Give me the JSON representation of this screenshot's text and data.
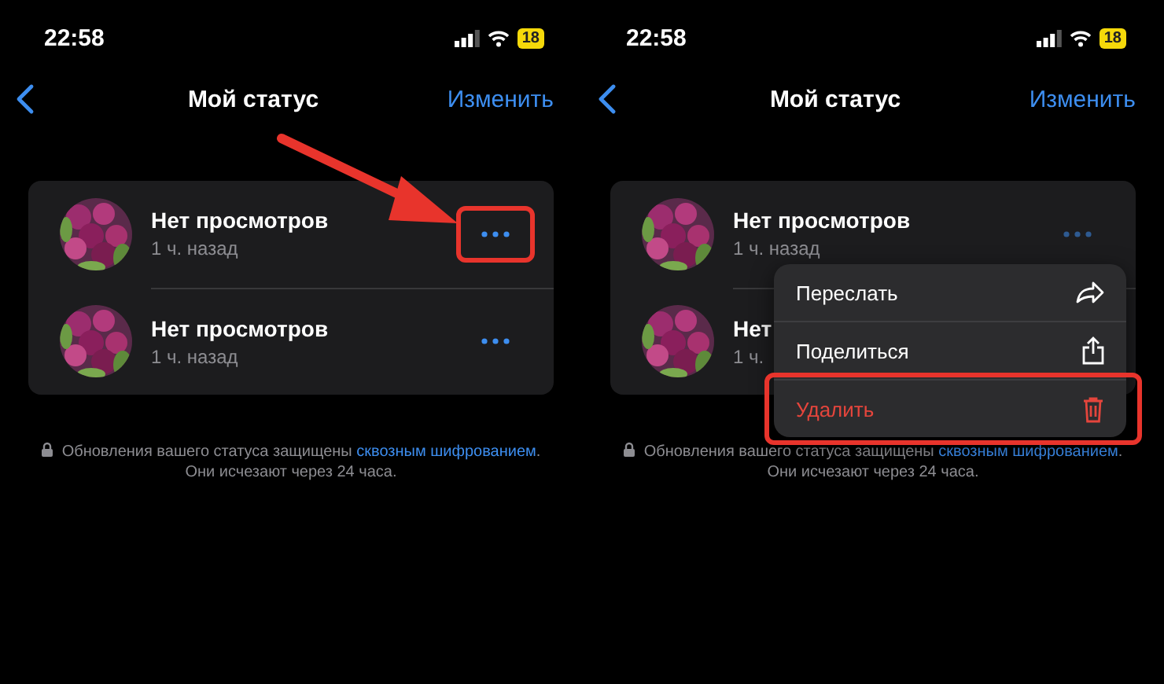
{
  "screens": [
    {
      "status_bar": {
        "time": "22:58",
        "battery": "18"
      },
      "title": "Мой статус",
      "action": "Изменить",
      "arrow": true,
      "statuses": [
        {
          "title": "Нет просмотров",
          "time": "1 ч. назад",
          "more_shown": true,
          "dimmed": false,
          "highlighted": true
        },
        {
          "title": "Нет просмотров",
          "time": "1 ч. назад",
          "more_shown": true,
          "dimmed": false,
          "highlighted": false
        }
      ],
      "note": {
        "text": "Обновления вашего статуса защищены ",
        "link": "сквозным шифрованием",
        "after": ". Они исчезают через 24 часа."
      }
    },
    {
      "status_bar": {
        "time": "22:58",
        "battery": "18"
      },
      "title": "Мой статус",
      "action": "Изменить",
      "statuses": [
        {
          "title": "Нет просмотров",
          "time": "1 ч. назад",
          "more_shown": true,
          "dimmed": true,
          "highlighted": false
        },
        {
          "title": "Нет",
          "time": "1 ч."
        }
      ],
      "menu": [
        {
          "label": "Переслать",
          "kind": "forward",
          "destructive": false,
          "highlighted": false
        },
        {
          "label": "Поделиться",
          "kind": "share",
          "destructive": false,
          "highlighted": false
        },
        {
          "label": "Удалить",
          "kind": "delete",
          "destructive": true,
          "highlighted": true
        }
      ],
      "note": {
        "text": "Обновления вашего статуса защищены ",
        "link": "сквозным шифрованием",
        "after": ". Они исчезают через 24 часа."
      }
    }
  ]
}
